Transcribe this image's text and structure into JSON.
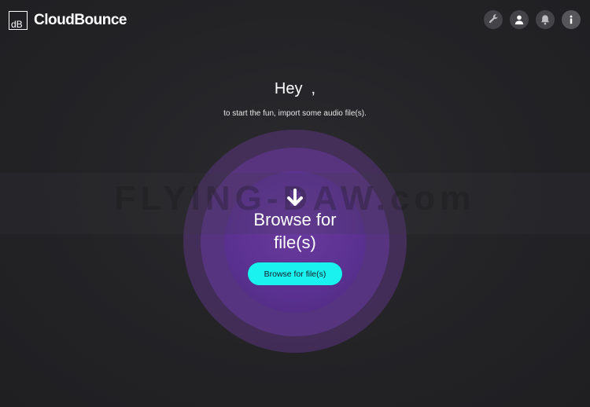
{
  "app": {
    "brand_mark": "dB",
    "brand_name": "CloudBounce"
  },
  "header": {
    "icons": [
      "wrench-icon",
      "user-icon",
      "bell-icon",
      "info-icon"
    ]
  },
  "main": {
    "greeting": "Hey  ,",
    "subtitle": "to start the fun, import some audio file(s).",
    "dropzone_title_line1": "Browse for",
    "dropzone_title_line2": "file(s)",
    "browse_button_label": "Browse for file(s)",
    "watermark": "FLYING-DAW.com"
  },
  "colors": {
    "accent": "#19f2ee",
    "circle_purple": "#5a3190",
    "background": "#232326"
  }
}
